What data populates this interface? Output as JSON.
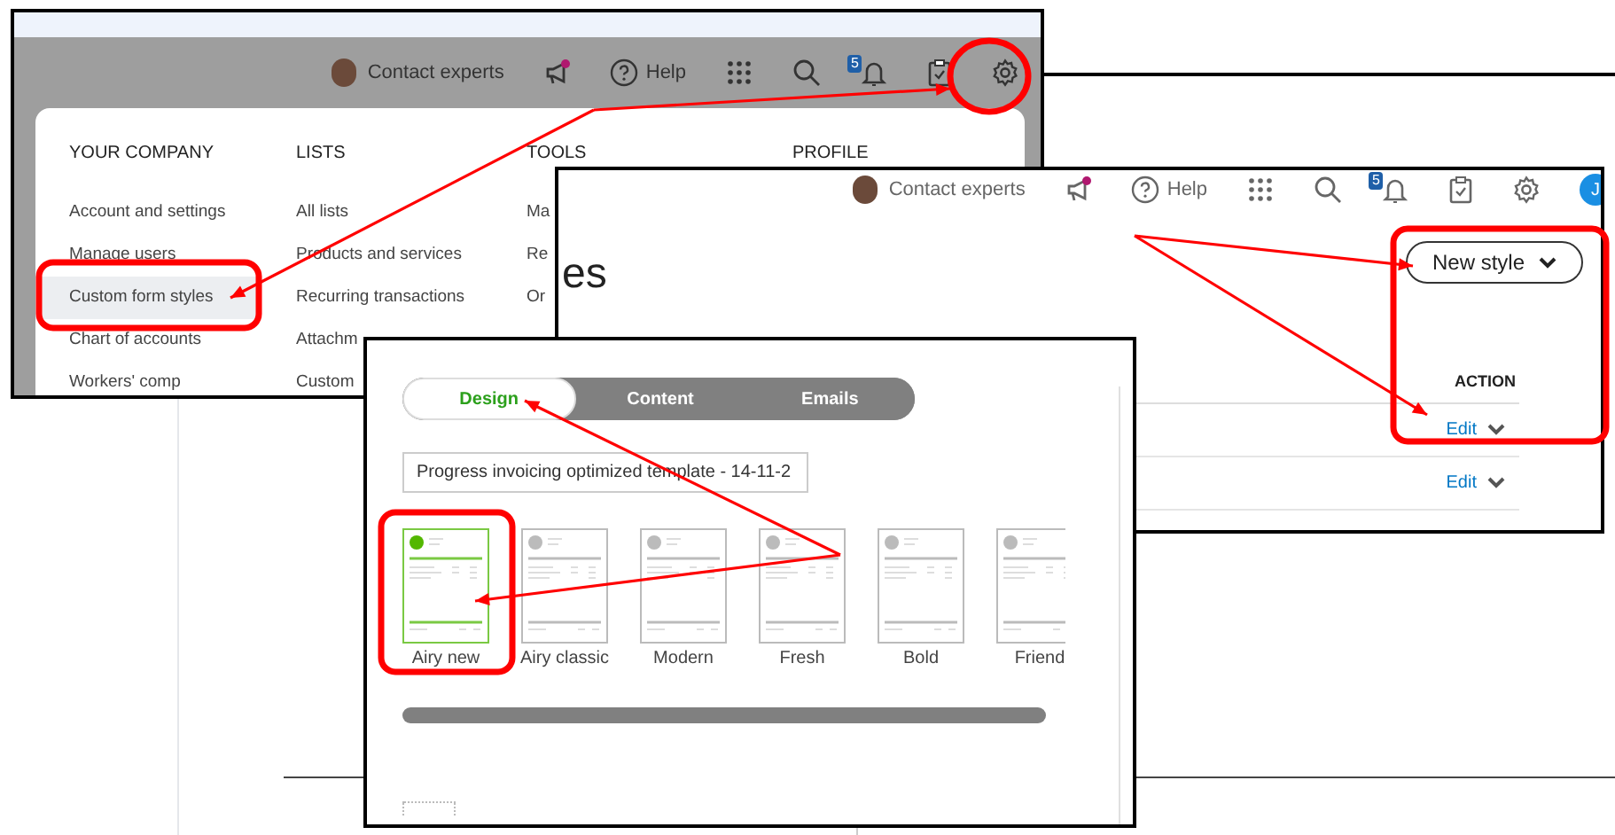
{
  "settings_screen": {
    "header": {
      "contact": "Contact experts",
      "help": "Help",
      "notification_count": "5"
    },
    "menu": {
      "columns": [
        {
          "heading": "YOUR COMPANY",
          "items": [
            {
              "label": "Account and settings",
              "selected": false
            },
            {
              "label": "Manage users",
              "selected": false
            },
            {
              "label": "Custom form styles",
              "selected": true
            },
            {
              "label": "Chart of accounts",
              "selected": false
            },
            {
              "label": "Workers' comp",
              "selected": false
            }
          ]
        },
        {
          "heading": "LISTS",
          "items": [
            {
              "label": "All lists",
              "selected": false
            },
            {
              "label": "Products and services",
              "selected": false
            },
            {
              "label": "Recurring transactions",
              "selected": false
            },
            {
              "label": "Attachm",
              "selected": false
            },
            {
              "label": "Custom",
              "selected": false
            }
          ]
        },
        {
          "heading": "TOOLS",
          "items": [
            {
              "label": "Ma",
              "selected": false
            },
            {
              "label": "Re",
              "selected": false
            },
            {
              "label": "Or",
              "selected": false
            }
          ]
        },
        {
          "heading": "PROFILE"
        }
      ]
    }
  },
  "styles_screen": {
    "header": {
      "contact": "Contact experts",
      "help": "Help",
      "notification_count": "5",
      "avatar_initial": "J"
    },
    "page_title": "es",
    "new_style_button": "New style",
    "table": {
      "columns": [
        "ACTION"
      ],
      "rows": [
        {
          "action": "Edit"
        },
        {
          "action": "Edit"
        }
      ]
    }
  },
  "editor_screen": {
    "tabs": [
      {
        "label": "Design",
        "selected": true
      },
      {
        "label": "Content",
        "selected": false
      },
      {
        "label": "Emails",
        "selected": false
      }
    ],
    "template_name": "Progress invoicing optimized template - 14-11-2",
    "templates": [
      {
        "label": "Airy new",
        "selected": true
      },
      {
        "label": "Airy classic",
        "selected": false
      },
      {
        "label": "Modern",
        "selected": false
      },
      {
        "label": "Fresh",
        "selected": false
      },
      {
        "label": "Bold",
        "selected": false
      },
      {
        "label": "Friend",
        "selected": false
      }
    ]
  }
}
